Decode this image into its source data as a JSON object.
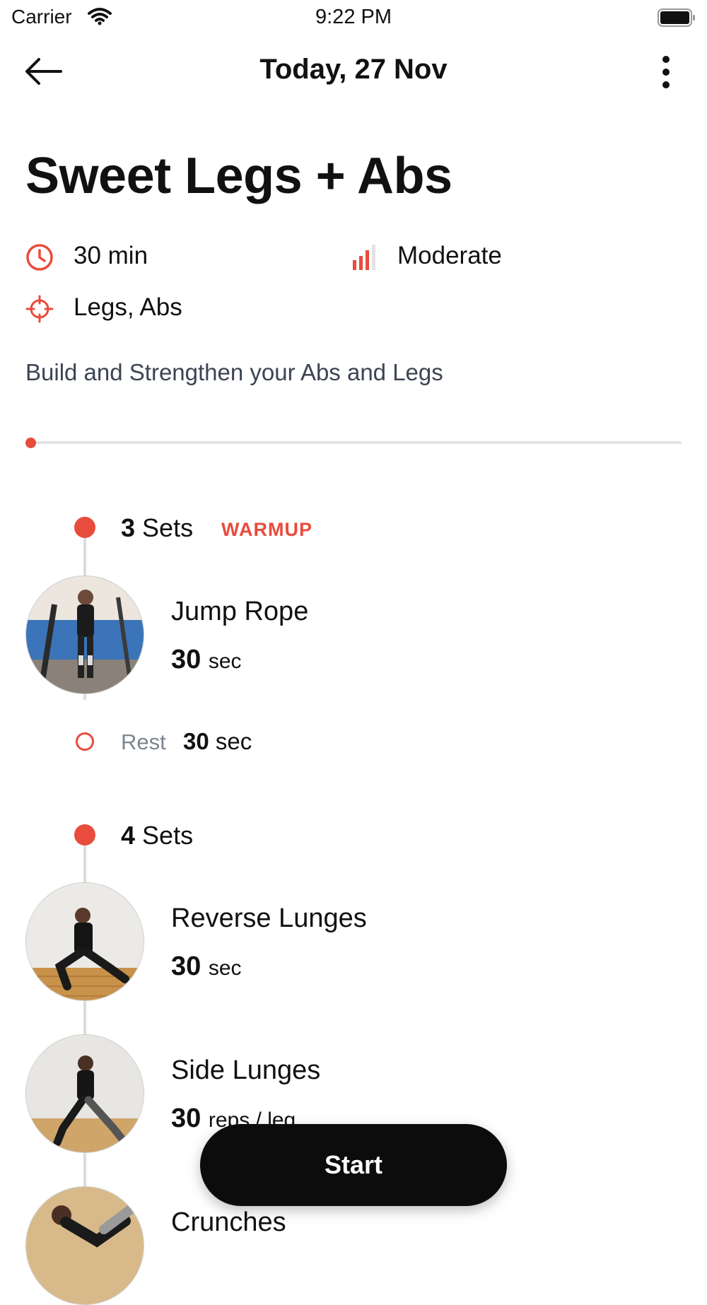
{
  "status_bar": {
    "carrier": "Carrier",
    "time": "9:22 PM"
  },
  "nav": {
    "title": "Today, 27 Nov"
  },
  "workout": {
    "title": "Sweet Legs + Abs",
    "duration": "30 min",
    "difficulty": "Moderate",
    "targets": "Legs, Abs",
    "description": "Build and Strengthen your Abs and Legs",
    "progress": 0
  },
  "blocks": [
    {
      "sets_count": "3",
      "sets_label": "Sets",
      "tag": "WARMUP",
      "exercises": [
        {
          "name": "Jump Rope",
          "value": "30",
          "unit": "sec"
        }
      ],
      "rest": {
        "label": "Rest",
        "value": "30",
        "unit": "sec"
      }
    },
    {
      "sets_count": "4",
      "sets_label": "Sets",
      "exercises": [
        {
          "name": "Reverse Lunges",
          "value": "30",
          "unit": "sec"
        },
        {
          "name": "Side Lunges",
          "value": "30",
          "unit": "reps / leg"
        },
        {
          "name": "Crunches"
        }
      ]
    }
  ],
  "actions": {
    "start_label": "Start"
  },
  "colors": {
    "accent": "#e84c3d",
    "button": "#0c0c0c",
    "description": "#3c4452"
  }
}
